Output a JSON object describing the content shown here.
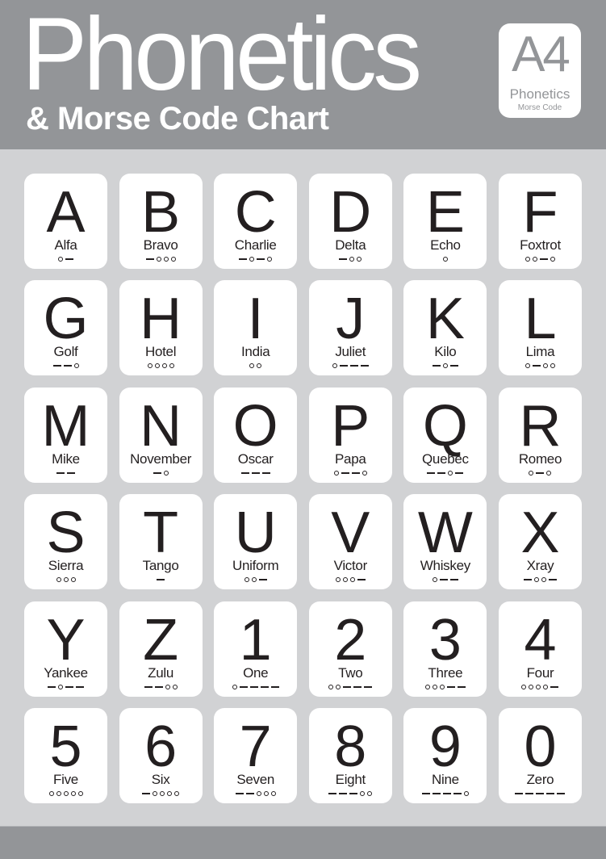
{
  "header": {
    "title": "Phonetics",
    "subtitle": "& Morse Code Chart",
    "badge": {
      "big": "A4",
      "mid": "Phonetics",
      "small": "Morse Code"
    }
  },
  "colors": {
    "header_gray": "#939598",
    "background": "#d1d2d4",
    "card": "#ffffff",
    "text": "#231f20"
  },
  "legend": {
    "dot": "hollow-circle",
    "dash": "bar"
  },
  "cards": [
    {
      "char": "A",
      "word": "Alfa",
      "morse": ".-"
    },
    {
      "char": "B",
      "word": "Bravo",
      "morse": "-..."
    },
    {
      "char": "C",
      "word": "Charlie",
      "morse": "-.-."
    },
    {
      "char": "D",
      "word": "Delta",
      "morse": "-.."
    },
    {
      "char": "E",
      "word": "Echo",
      "morse": "."
    },
    {
      "char": "F",
      "word": "Foxtrot",
      "morse": "..-."
    },
    {
      "char": "G",
      "word": "Golf",
      "morse": "--."
    },
    {
      "char": "H",
      "word": "Hotel",
      "morse": "...."
    },
    {
      "char": "I",
      "word": "India",
      "morse": ".."
    },
    {
      "char": "J",
      "word": "Juliet",
      "morse": ".---"
    },
    {
      "char": "K",
      "word": "Kilo",
      "morse": "-.-"
    },
    {
      "char": "L",
      "word": "Lima",
      "morse": ".-.."
    },
    {
      "char": "M",
      "word": "Mike",
      "morse": "--"
    },
    {
      "char": "N",
      "word": "November",
      "morse": "-."
    },
    {
      "char": "O",
      "word": "Oscar",
      "morse": "---"
    },
    {
      "char": "P",
      "word": "Papa",
      "morse": ".--."
    },
    {
      "char": "Q",
      "word": "Quebec",
      "morse": "--.-"
    },
    {
      "char": "R",
      "word": "Romeo",
      "morse": ".-."
    },
    {
      "char": "S",
      "word": "Sierra",
      "morse": "..."
    },
    {
      "char": "T",
      "word": "Tango",
      "morse": "-"
    },
    {
      "char": "U",
      "word": "Uniform",
      "morse": "..-"
    },
    {
      "char": "V",
      "word": "Victor",
      "morse": "...-"
    },
    {
      "char": "W",
      "word": "Whiskey",
      "morse": ".--"
    },
    {
      "char": "X",
      "word": "Xray",
      "morse": "-..-"
    },
    {
      "char": "Y",
      "word": "Yankee",
      "morse": "-.--"
    },
    {
      "char": "Z",
      "word": "Zulu",
      "morse": "--.."
    },
    {
      "char": "1",
      "word": "One",
      "morse": ".----"
    },
    {
      "char": "2",
      "word": "Two",
      "morse": "..---"
    },
    {
      "char": "3",
      "word": "Three",
      "morse": "...--"
    },
    {
      "char": "4",
      "word": "Four",
      "morse": "....-"
    },
    {
      "char": "5",
      "word": "Five",
      "morse": "....."
    },
    {
      "char": "6",
      "word": "Six",
      "morse": "-...."
    },
    {
      "char": "7",
      "word": "Seven",
      "morse": "--..."
    },
    {
      "char": "8",
      "word": "Eight",
      "morse": "---.."
    },
    {
      "char": "9",
      "word": "Nine",
      "morse": "----."
    },
    {
      "char": "0",
      "word": "Zero",
      "morse": "-----"
    }
  ]
}
